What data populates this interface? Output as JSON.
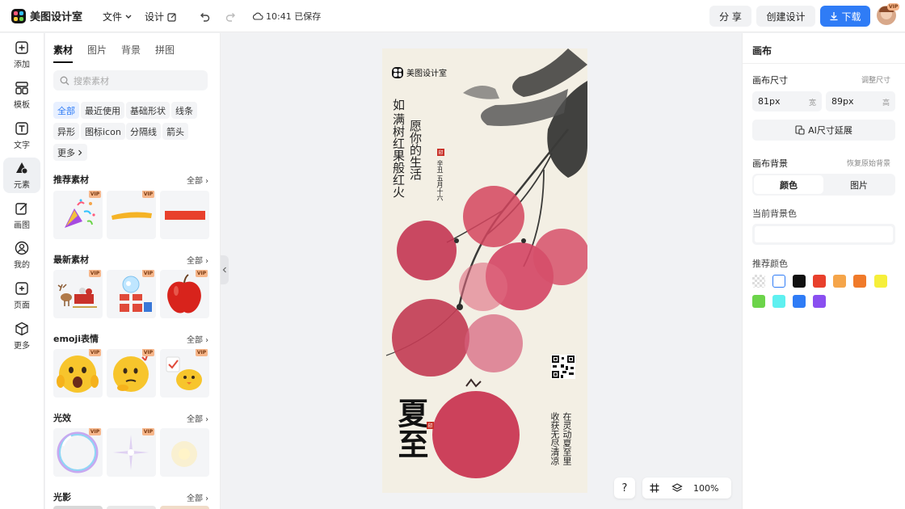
{
  "header": {
    "app_name": "美图设计室",
    "menu_file": "文件",
    "menu_design": "设计",
    "save_status": "10:41 已保存",
    "share_label": "分 享",
    "create_label": "创建设计",
    "download_label": "下载",
    "avatar_badge": "VIP"
  },
  "nav": [
    {
      "label": "添加",
      "icon": "plus-square-icon"
    },
    {
      "label": "模板",
      "icon": "template-grid-icon"
    },
    {
      "label": "文字",
      "icon": "text-icon"
    },
    {
      "label": "元素",
      "icon": "shapes-icon"
    },
    {
      "label": "画图",
      "icon": "pen-edit-icon"
    },
    {
      "label": "我的",
      "icon": "user-icon"
    },
    {
      "label": "页面",
      "icon": "page-add-icon"
    },
    {
      "label": "更多",
      "icon": "cube-icon"
    }
  ],
  "panel": {
    "tabs": [
      "素材",
      "图片",
      "背景",
      "拼图"
    ],
    "search_placeholder": "搜索素材",
    "chips": [
      "全部",
      "最近使用",
      "基础形状",
      "线条",
      "异形",
      "图标icon",
      "分隔线",
      "箭头",
      "更多"
    ],
    "all_label": "全部",
    "vip": "VIP",
    "sections": [
      {
        "title": "推荐素材"
      },
      {
        "title": "最新素材"
      },
      {
        "title": "emoji表情"
      },
      {
        "title": "光效"
      },
      {
        "title": "光影"
      }
    ]
  },
  "poster": {
    "brand": "美图设计室",
    "poem_line1": "如",
    "poem_line2": "满树红果般红火",
    "poem_line3": "愿你的生活",
    "date": "辛丑 五月十六",
    "big_title": "夏至",
    "right_col1": "在灵动夏至里",
    "right_col2": "收获无尽清凉",
    "seal": "印"
  },
  "canvas_tools": {
    "help": "?",
    "zoom": "100%"
  },
  "right_panel": {
    "title": "画布",
    "size_label": "画布尺寸",
    "resize_link": "调整尺寸",
    "width_value": "81px",
    "width_unit": "宽",
    "height_value": "89px",
    "height_unit": "高",
    "ai_extend": "AI尺寸延展",
    "bg_label": "画布背景",
    "restore_bg": "恢复原始背景",
    "bg_tab_color": "颜色",
    "bg_tab_image": "图片",
    "current_bg_label": "当前背景色",
    "recommended_label": "推荐颜色",
    "colors": [
      "transparent",
      "#ffffff",
      "#111111",
      "#e8402c",
      "#f5a54a",
      "#f07a2a",
      "#f6ef3a",
      "#6cd44a",
      "#5ef0f0",
      "#2f7cf6",
      "#8a4ff0"
    ]
  }
}
